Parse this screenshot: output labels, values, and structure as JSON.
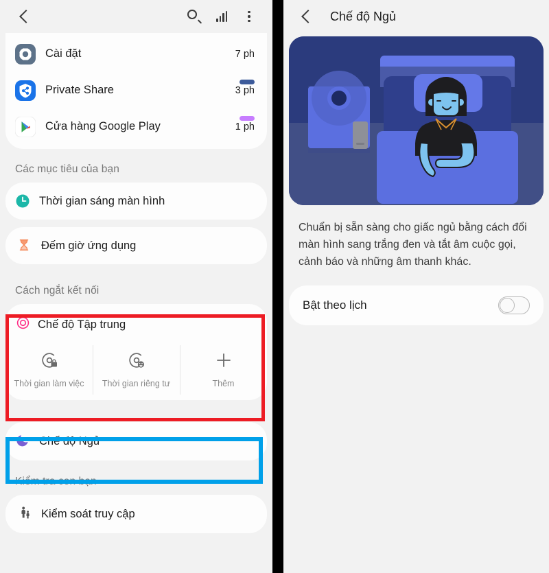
{
  "left": {
    "topbar": {
      "back_icon": "chevron-left-icon",
      "search_icon": "search-icon",
      "stats_icon": "bar-chart-icon",
      "overflow_icon": "more-vertical-icon"
    },
    "apps": [
      {
        "icon": "settings-gear-icon",
        "name": "Cài đặt",
        "time": "7 ph",
        "bar_color": ""
      },
      {
        "icon": "private-share-icon",
        "name": "Private Share",
        "time": "3 ph",
        "bar_color": "#3c5a9a"
      },
      {
        "icon": "google-play-icon",
        "name": "Cửa hàng Google Play",
        "time": "1 ph",
        "bar_color": "#c77dff"
      }
    ],
    "goals_section": {
      "label": "Các mục tiêu của bạn",
      "items": [
        {
          "icon": "clock-icon",
          "label": "Thời gian sáng màn hình",
          "color": "#1cb7a8"
        },
        {
          "icon": "hourglass-icon",
          "label": "Đếm giờ ứng dụng",
          "color": "#f58a5b"
        }
      ]
    },
    "disconnect_section": {
      "label": "Cách ngắt kết nối",
      "focus": {
        "icon": "focus-target-icon",
        "label": "Chế độ Tập trung",
        "accent": "#ff2d87",
        "tiles": [
          {
            "icon": "work-time-icon",
            "label": "Thời gian làm việc"
          },
          {
            "icon": "me-time-icon",
            "label": "Thời gian riêng tư"
          },
          {
            "icon": "plus-icon",
            "label": "Thêm"
          }
        ]
      },
      "sleep": {
        "icon": "moon-icon",
        "label": "Chế độ Ngủ",
        "color": "#7a5fd3"
      }
    },
    "parental_section": {
      "label": "Kiểm tra con bạn",
      "item": {
        "icon": "parental-control-icon",
        "label": "Kiểm soát truy cập"
      }
    },
    "highlights": [
      {
        "name": "focus-mode-highlight",
        "color": "#ed1c24"
      },
      {
        "name": "sleep-mode-highlight",
        "color": "#00a0e9"
      }
    ]
  },
  "right": {
    "topbar": {
      "back_icon": "chevron-left-icon",
      "title": "Chế độ Ngủ"
    },
    "illustration": {
      "name": "person-sleeping-in-bed-illustration",
      "colors": {
        "bg_dark": "#2b3b7d",
        "wall": "#414f86",
        "bed": "#5b6fe0",
        "pillow": "#6478e8",
        "headboard": "#4a5aa8",
        "skin": "#7ec3ef",
        "hair": "#1d1d20",
        "lamp": "#5b6fe0"
      }
    },
    "description": "Chuẩn bị sẵn sàng cho giấc ngủ bằng cách đổi màn hình sang trắng đen và tắt âm cuộc gọi, cảnh báo và những âm thanh khác.",
    "schedule": {
      "label": "Bật theo lịch",
      "toggle_state": "off"
    }
  }
}
